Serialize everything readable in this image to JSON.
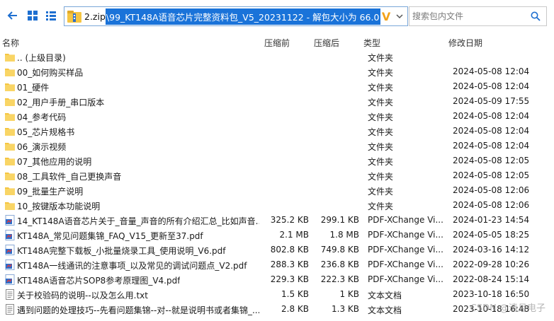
{
  "addressbar": {
    "prefix": "2.zip",
    "selected_path": "\\99_KT148A语音芯片完整资料包_V5_20231122 - 解包大小为 66.0 MB",
    "verified_mark": "V"
  },
  "search": {
    "placeholder": "搜索包内文件"
  },
  "columns": {
    "name": "名称",
    "compressed": "压缩前",
    "size": "压缩后",
    "type": "类型",
    "modified": "修改日期"
  },
  "rows": [
    {
      "icon": "folder-icon",
      "name": ".. (上级目录)",
      "compressed": "",
      "size": "",
      "type": "文件夹",
      "modified": ""
    },
    {
      "icon": "folder-icon",
      "name": "00_如何购买样品",
      "compressed": "",
      "size": "",
      "type": "文件夹",
      "modified": "2024-05-08 12:04"
    },
    {
      "icon": "folder-icon",
      "name": "01_硬件",
      "compressed": "",
      "size": "",
      "type": "文件夹",
      "modified": "2024-05-08 12:04"
    },
    {
      "icon": "folder-icon",
      "name": "02_用户手册_串口版本",
      "compressed": "",
      "size": "",
      "type": "文件夹",
      "modified": "2024-05-09 17:55"
    },
    {
      "icon": "folder-icon",
      "name": "04_参考代码",
      "compressed": "",
      "size": "",
      "type": "文件夹",
      "modified": "2024-05-08 12:04"
    },
    {
      "icon": "folder-icon",
      "name": "05_芯片规格书",
      "compressed": "",
      "size": "",
      "type": "文件夹",
      "modified": "2024-05-08 12:04"
    },
    {
      "icon": "folder-icon",
      "name": "06_演示视频",
      "compressed": "",
      "size": "",
      "type": "文件夹",
      "modified": "2024-05-08 12:04"
    },
    {
      "icon": "folder-icon",
      "name": "07_其他应用的说明",
      "compressed": "",
      "size": "",
      "type": "文件夹",
      "modified": "2024-05-08 12:05"
    },
    {
      "icon": "folder-icon",
      "name": "08_工具软件_自己更换声音",
      "compressed": "",
      "size": "",
      "type": "文件夹",
      "modified": "2024-05-08 12:05"
    },
    {
      "icon": "folder-icon",
      "name": "09_批量生产说明",
      "compressed": "",
      "size": "",
      "type": "文件夹",
      "modified": "2024-05-08 12:06"
    },
    {
      "icon": "folder-icon",
      "name": "10_按键版本功能说明",
      "compressed": "",
      "size": "",
      "type": "文件夹",
      "modified": "2024-05-08 12:06"
    },
    {
      "icon": "pdf-icon",
      "name": "14_KT148A语音芯片关于_音量_声音的所有介绍汇总_比如声音...",
      "compressed": "325.2 KB",
      "size": "299.1 KB",
      "type": "PDF-XChange Vi...",
      "modified": "2024-01-23 14:54"
    },
    {
      "icon": "pdf-icon",
      "name": "KT148A_常见问题集锦_FAQ_V15_更新至37.pdf",
      "compressed": "2.1 MB",
      "size": "1.8 MB",
      "type": "PDF-XChange Vi...",
      "modified": "2024-05-05 18:25"
    },
    {
      "icon": "pdf-icon",
      "name": "KT148A完整下载板_小批量烧录工具_使用说明_V6.pdf",
      "compressed": "802.8 KB",
      "size": "749.8 KB",
      "type": "PDF-XChange Vi...",
      "modified": "2024-03-16 14:12"
    },
    {
      "icon": "pdf-icon",
      "name": "KT148A一线通讯的注意事项_以及常见的调试问题点_V2.pdf",
      "compressed": "288.3 KB",
      "size": "236.8 KB",
      "type": "PDF-XChange Vi...",
      "modified": "2022-09-28 10:26"
    },
    {
      "icon": "pdf-icon",
      "name": "KT148A语音芯片SOP8参考原理图_V4.pdf",
      "compressed": "229.3 KB",
      "size": "222.3 KB",
      "type": "PDF-XChange Vi...",
      "modified": "2022-08-24 15:14"
    },
    {
      "icon": "txt-icon",
      "name": "关于校验码的说明--以及怎么用.txt",
      "compressed": "1.5 KB",
      "size": "1 KB",
      "type": "文本文档",
      "modified": "2023-10-18 16:50"
    },
    {
      "icon": "txt-icon",
      "name": "遇到问题的处理技巧--先看问题集锦--对--就是说明书或者集锦_...",
      "compressed": "2.8 KB",
      "size": "1.3 KB",
      "type": "文本文档",
      "modified": "2023-10-18 16:48"
    }
  ],
  "watermark": "CSDN @清月电子",
  "colors": {
    "accent": "#1a73d9",
    "folder": "#f5c542",
    "pdf": "#2c6ecb"
  }
}
